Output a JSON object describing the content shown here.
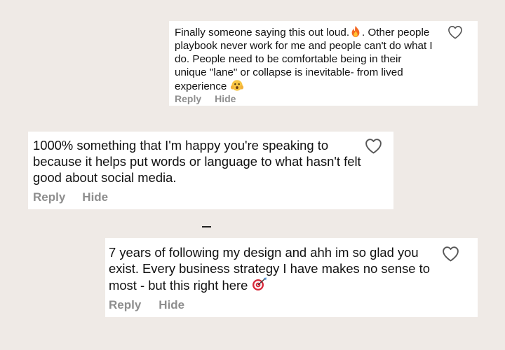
{
  "comments": [
    {
      "text_before_emoji": "Finally someone saying this out loud.",
      "text_mid": ". Other people playbook never work for me and people can't do what I do. People need to be comfortable being in their unique \"lane\" or collapse is inevitable- from lived experience",
      "emoji_1": "fire-emoji",
      "emoji_2": "shocked-face-emoji",
      "reply_label": "Reply",
      "hide_label": "Hide"
    },
    {
      "text": "1000% something that I'm happy you're speaking to because it helps put words or language to what hasn't felt good about social media.",
      "reply_label": "Reply",
      "hide_label": "Hide"
    },
    {
      "text": "7 years of following my design and ahh im so glad you exist. Every business strategy I have makes no sense to most - but this right here",
      "emoji": "bullseye-emoji",
      "reply_label": "Reply",
      "hide_label": "Hide"
    }
  ],
  "colors": {
    "background": "#efeae6",
    "card": "#ffffff",
    "text": "#111111",
    "action_text": "#8e8e8e"
  },
  "icons": {
    "like": "heart-outline-icon"
  }
}
